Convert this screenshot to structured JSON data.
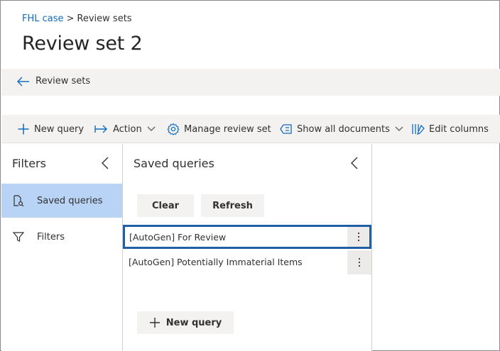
{
  "breadcrumb": {
    "parent": "FHL case",
    "separator": ">",
    "current": "Review sets"
  },
  "page": {
    "title": "Review set 2"
  },
  "backbar": {
    "label": "Review sets",
    "icon": "arrow-left-icon"
  },
  "commands": {
    "new_query": "New query",
    "action": "Action",
    "manage_review_set": "Manage review set",
    "show_all_documents": "Show all documents",
    "edit_columns": "Edit columns"
  },
  "filters_panel": {
    "title": "Filters",
    "items": [
      {
        "label": "Saved queries",
        "icon": "saved-query-icon",
        "selected": true
      },
      {
        "label": "Filters",
        "icon": "funnel-icon",
        "selected": false
      }
    ]
  },
  "saved_queries_panel": {
    "title": "Saved queries",
    "clear_label": "Clear",
    "refresh_label": "Refresh",
    "queries": [
      {
        "label": "[AutoGen] For Review",
        "focused": true
      },
      {
        "label": "[AutoGen] Potentially Immaterial Items",
        "focused": false
      }
    ],
    "new_query_label": "New query"
  },
  "colors": {
    "link": "#0f6cbd",
    "selected_nav": "#b8d3f6",
    "focus_border": "#1f5fa6",
    "bar_bg": "#f3f2f1"
  }
}
